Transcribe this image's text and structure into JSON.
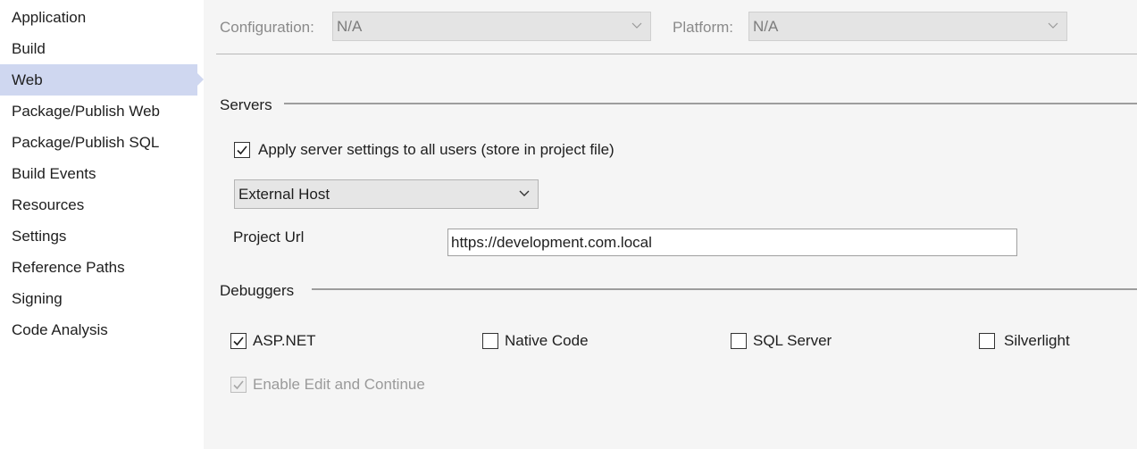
{
  "sidebar": {
    "items": [
      {
        "label": "Application"
      },
      {
        "label": "Build"
      },
      {
        "label": "Web",
        "selected": true
      },
      {
        "label": "Package/Publish Web"
      },
      {
        "label": "Package/Publish SQL"
      },
      {
        "label": "Build Events"
      },
      {
        "label": "Resources"
      },
      {
        "label": "Settings"
      },
      {
        "label": "Reference Paths"
      },
      {
        "label": "Signing"
      },
      {
        "label": "Code Analysis"
      }
    ]
  },
  "toolbar": {
    "configuration_label": "Configuration:",
    "configuration_value": "N/A",
    "platform_label": "Platform:",
    "platform_value": "N/A"
  },
  "servers": {
    "title": "Servers",
    "apply_all_label": "Apply server settings to all users (store in project file)",
    "apply_all_checked": true,
    "server_type": "External Host",
    "project_url_label": "Project Url",
    "project_url_value": "https://development.com.local"
  },
  "debuggers": {
    "title": "Debuggers",
    "aspnet_label": "ASP.NET",
    "aspnet_checked": true,
    "native_label": "Native Code",
    "native_checked": false,
    "sql_label": "SQL Server",
    "sql_checked": false,
    "silverlight_label": "Silverlight",
    "silverlight_checked": false,
    "edit_continue_label": "Enable Edit and Continue",
    "edit_continue_checked": true,
    "edit_continue_enabled": false
  },
  "colors": {
    "selected_nav": "#cfd7f0",
    "panel_bg": "#f5f5f5"
  }
}
